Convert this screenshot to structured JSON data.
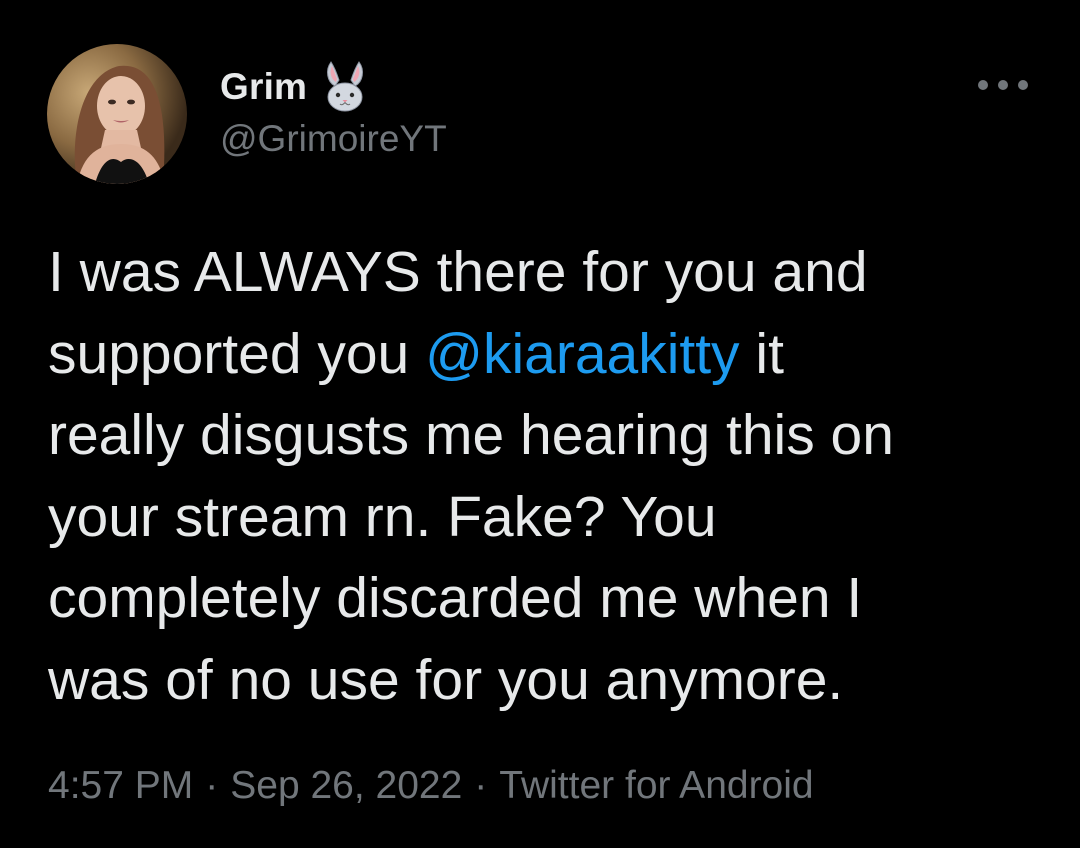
{
  "author": {
    "display_name": "Grim",
    "emoji": "rabbit-face",
    "handle": "@GrimoireYT"
  },
  "tweet": {
    "lines": [
      [
        "I was ALWAYS there for you and"
      ],
      [
        "supported you ",
        "@kiaraakitty",
        " it"
      ],
      [
        "really disgusts me hearing this on"
      ],
      [
        "your stream rn. Fake? You"
      ],
      [
        "completely discarded me when I"
      ],
      [
        "was of no use for you anymore."
      ]
    ],
    "mention": "@kiaraakitty"
  },
  "meta": {
    "time": "4:57 PM",
    "separator": "·",
    "date": "Sep 26, 2022",
    "source": "Twitter for Android"
  },
  "colors": {
    "background": "#000000",
    "text": "#e7e9ea",
    "secondary": "#71767b",
    "link": "#1d9bf0"
  },
  "icons": {
    "more": "more-horizontal-icon",
    "emoji": "rabbit-face-icon"
  }
}
